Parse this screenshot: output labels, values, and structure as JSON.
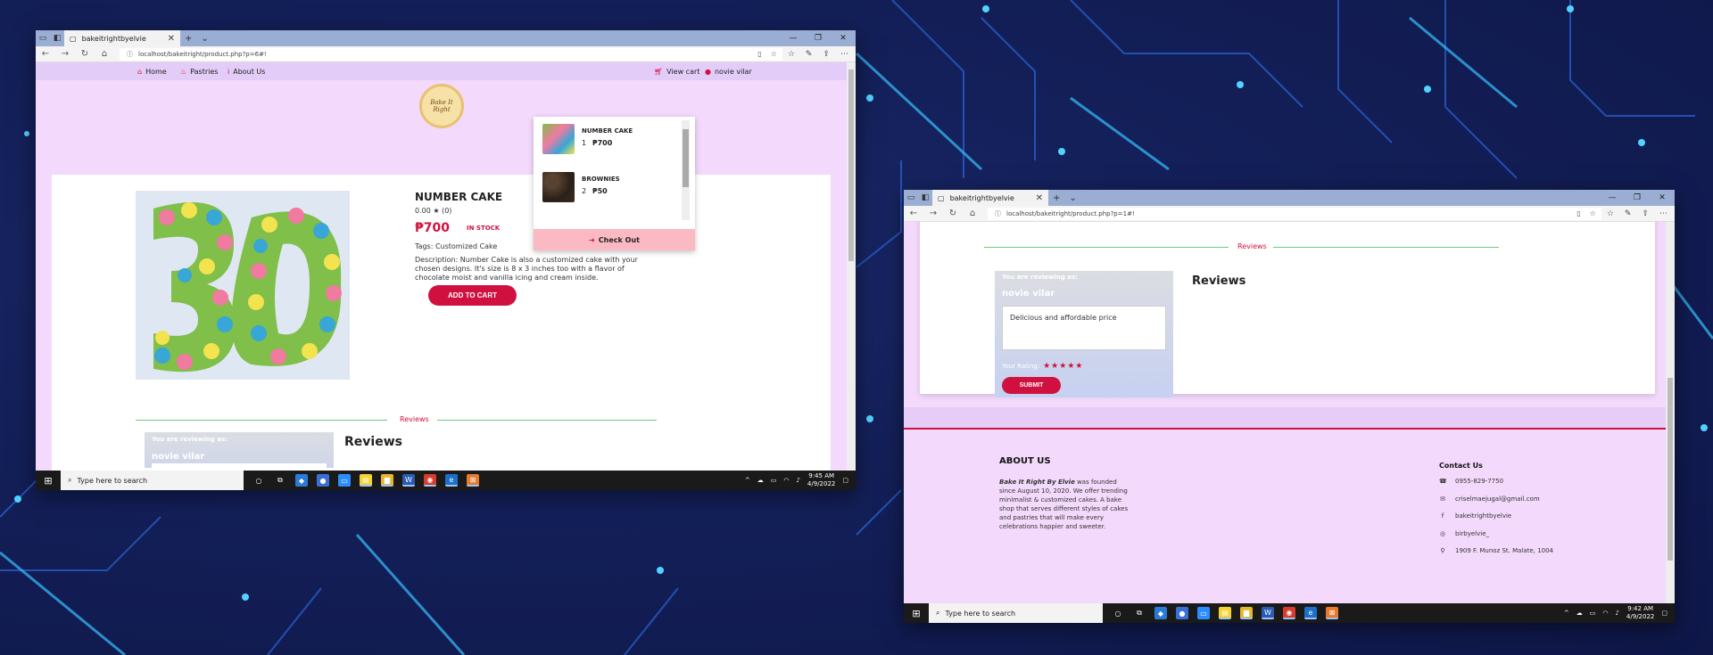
{
  "window1": {
    "tab_title": "bakeitrightbyelvie",
    "url": "localhost/bakeitright/product.php?p=6#!",
    "nav": {
      "home": "Home",
      "pastries": "Pastries",
      "about": "About Us",
      "view_cart": "View cart",
      "user": "novie vilar"
    },
    "logo_text": "Bake It Right",
    "product": {
      "title": "NUMBER CAKE",
      "rating": "0.00 ★ (0)",
      "price": "₱700",
      "stock": "IN STOCK",
      "tags": "Tags: Customized Cake",
      "description": "Description: Number Cake is also a customized cake with your chosen designs. It's size is 8 x 3 inches too with a flavor of chocolate moist and vanilla icing and cream inside.",
      "add_to_cart": "ADD TO CART",
      "image_text": "30"
    },
    "reviews_divider": "Reviews",
    "review_form": {
      "label": "You are reviewing as:",
      "name": "novie vilar"
    },
    "reviews_title": "Reviews",
    "cart": {
      "items": [
        {
          "name": "NUMBER CAKE",
          "qty": "1",
          "price": "₱700"
        },
        {
          "name": "BROWNIES",
          "qty": "2",
          "price": "₱50"
        }
      ],
      "checkout": "Check Out"
    },
    "taskbar": {
      "search_placeholder": "Type here to search",
      "time": "9:45 AM",
      "date": "4/9/2022"
    }
  },
  "window2": {
    "tab_title": "bakeitrightbyelvie",
    "url": "localhost/bakeitright/product.php?p=1#!",
    "reviews_divider": "Reviews",
    "review_form": {
      "label": "You are reviewing as:",
      "name": "novie vilar",
      "textarea_value": "Delicious and affordable price",
      "rating_label": "Your Rating:",
      "stars": "★★★★★",
      "submit": "SUBMIT"
    },
    "reviews_title": "Reviews",
    "footer": {
      "about_heading": "ABOUT US",
      "about_brand": "Bake It Right By Elvie",
      "about_text": " was founded since August 10, 2020. We offer trending minimalist & customized cakes. A bake shop that serves different styles of cakes and pastries that will make every celebrations happier and sweeter.",
      "contact_heading": "Contact Us",
      "contacts": [
        {
          "icon": "phone-icon",
          "text": "0955-829-7750"
        },
        {
          "icon": "mail-icon",
          "text": "criselmaejugal@gmail.com"
        },
        {
          "icon": "facebook-icon",
          "text": "bakeitrightbyelvie"
        },
        {
          "icon": "instagram-icon",
          "text": "birbyelvie_"
        },
        {
          "icon": "location-icon",
          "text": "1909 F. Munoz St. Malate, 1004"
        }
      ]
    },
    "taskbar": {
      "search_placeholder": "Type here to search",
      "time": "9:42 AM",
      "date": "4/9/2022"
    }
  },
  "colors": {
    "accent": "#d0113f",
    "page_bg": "#f3d9fb",
    "divider": "#6acb7d"
  }
}
